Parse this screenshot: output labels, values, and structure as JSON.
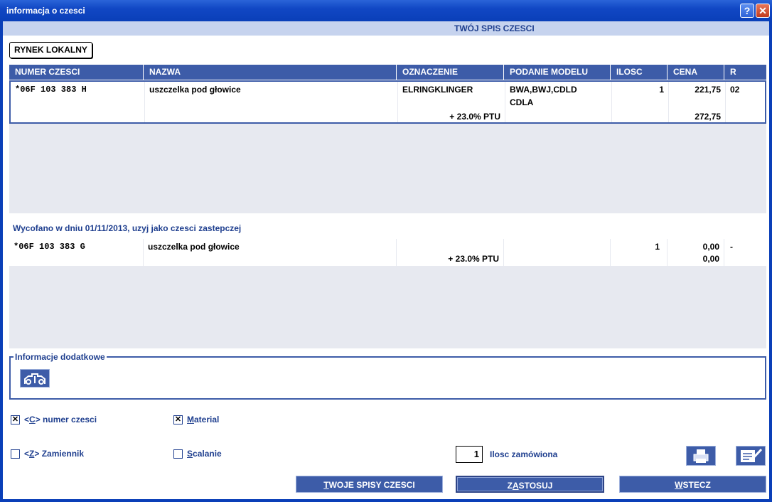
{
  "window": {
    "title": "informacja o czesci",
    "help_label": "?",
    "close_label": "✕"
  },
  "header": {
    "subtitle": "TWÓJ SPIS CZESCI"
  },
  "rynek_button": "RYNEK LOKALNY",
  "columns": [
    "NUMER CZESCI",
    "NAZWA",
    "OZNACZENIE",
    "PODANIE MODELU",
    "ILOSC",
    "CENA",
    "R"
  ],
  "rows": [
    {
      "number": "*06F 103 383 H",
      "name": "uszczelka pod głowice",
      "oznaczenie": "ELRINGKLINGER",
      "ptu": "+ 23.0% PTU",
      "model_line1": "BWA,BWJ,CDLD",
      "model_line2": "CDLA",
      "ilosc": "1",
      "cena": "221,75",
      "cena_brutto": "272,75",
      "r": "02"
    }
  ],
  "withdrawn_notice": "Wycofano w dniu 01/11/2013, uzyj jako czesci zastepczej",
  "replacement_rows": [
    {
      "number": "*06F 103 383 G",
      "name": "uszczelka pod głowice",
      "oznaczenie": "",
      "ptu": "+ 23.0% PTU",
      "model_line1": "",
      "model_line2": "",
      "ilosc": "1",
      "cena": "0,00",
      "cena_brutto": "0,00",
      "r": "-"
    }
  ],
  "info": {
    "label": "Informacje dodatkowe",
    "icon": "engine-icon"
  },
  "checkboxes": [
    {
      "label_pre": "<",
      "hotkey": "C",
      "label_post": "> numer czesci",
      "checked": true
    },
    {
      "label_pre": "",
      "hotkey": "M",
      "label_post": "aterial",
      "checked": true
    },
    {
      "label_pre": "<",
      "hotkey": "Z",
      "label_post": "> Zamiennik",
      "checked": false
    },
    {
      "label_pre": "",
      "hotkey": "S",
      "label_post": "calanie",
      "checked": false
    }
  ],
  "check_mark": "✕",
  "quantity": {
    "value": "1",
    "label": "Ilosc zamówiona"
  },
  "icon_buttons": [
    "printer-icon",
    "edit-notes-icon"
  ],
  "buttons": [
    {
      "hotkey": "T",
      "rest": "WOJE SPISY CZESCI"
    },
    {
      "pre": "Z",
      "hotkey": "A",
      "rest": "STOSUJ"
    },
    {
      "hotkey": "W",
      "rest": "STECZ"
    }
  ],
  "colors": {
    "titlebar": "#0a3fb8",
    "header_row": "#3d5ca8",
    "accent_text": "#1f3f8f",
    "grid_bg": "#e7e9f0"
  }
}
